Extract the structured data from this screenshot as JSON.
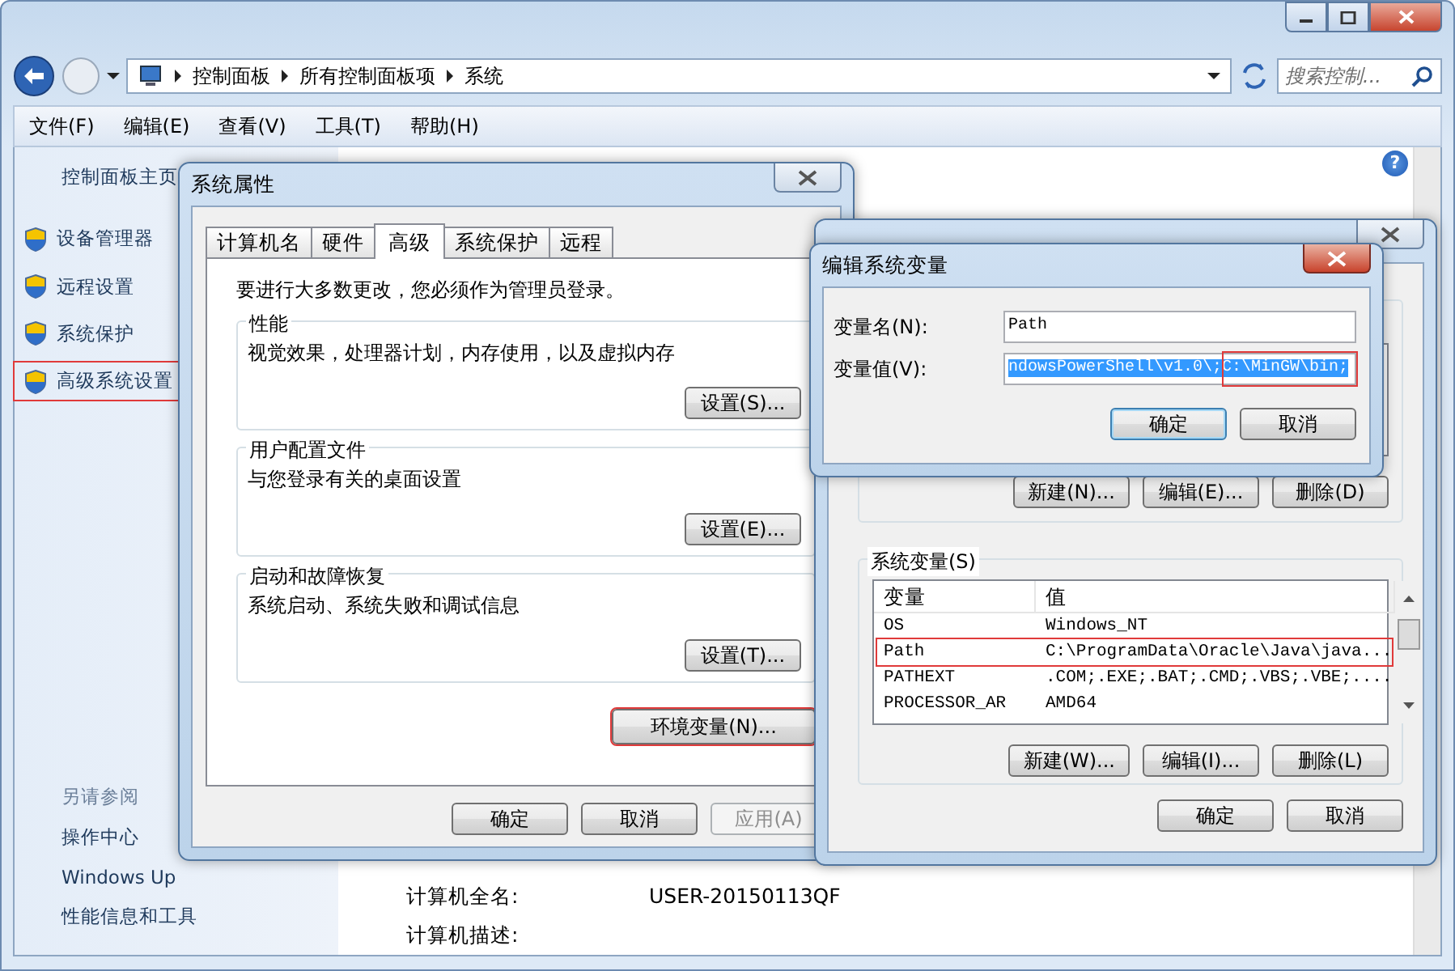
{
  "explorer": {
    "address": {
      "crumbs": [
        "控制面板",
        "所有控制面板项",
        "系统"
      ]
    },
    "search": {
      "placeholder": "搜索控制..."
    },
    "menu": [
      "文件(F)",
      "编辑(E)",
      "查看(V)",
      "工具(T)",
      "帮助(H)"
    ],
    "help": "?",
    "sidebar": {
      "home": "控制面板主页",
      "tasks": [
        {
          "label": "设备管理器",
          "highlighted": false
        },
        {
          "label": "远程设置",
          "highlighted": false
        },
        {
          "label": "系统保护",
          "highlighted": false
        },
        {
          "label": "高级系统设置",
          "highlighted": true
        }
      ],
      "see_also": "另请参阅",
      "links": [
        "操作中心",
        "Windows Up",
        "性能信息和工具"
      ]
    },
    "details": [
      {
        "label": "计算机全名:",
        "value": "USER-20150113QF"
      },
      {
        "label": "计算机描述:"
      }
    ]
  },
  "system_properties": {
    "title": "系统属性",
    "tabs": [
      {
        "label": "计算机名",
        "selected": false
      },
      {
        "label": "硬件",
        "selected": false
      },
      {
        "label": "高级",
        "selected": true
      },
      {
        "label": "系统保护",
        "selected": false
      },
      {
        "label": "远程",
        "selected": false
      }
    ],
    "note": "要进行大多数更改，您必须作为管理员登录。",
    "groups": [
      {
        "title": "性能",
        "description": "视觉效果，处理器计划，内存使用，以及虚拟内存",
        "button": "设置(S)..."
      },
      {
        "title": "用户配置文件",
        "description": "与您登录有关的桌面设置",
        "button": "设置(E)..."
      },
      {
        "title": "启动和故障恢复",
        "description": "系统启动、系统失败和调试信息",
        "button": "设置(T)..."
      }
    ],
    "env_button": {
      "label": "环境变量(N)...",
      "highlighted": true
    },
    "buttons": [
      {
        "label": "确定",
        "disabled": false
      },
      {
        "label": "取消",
        "disabled": false
      },
      {
        "label": "应用(A)",
        "disabled": true
      }
    ]
  },
  "environment_variables": {
    "user_buttons": [
      "新建(N)...",
      "编辑(E)...",
      "删除(D)"
    ],
    "system_group": "系统变量(S)",
    "columns": [
      "变量",
      "值"
    ],
    "rows": [
      {
        "name": "OS",
        "value": "Windows_NT",
        "highlighted": false
      },
      {
        "name": "Path",
        "value": "C:\\ProgramData\\Oracle\\Java\\java...",
        "highlighted": true
      },
      {
        "name": "PATHEXT",
        "value": ".COM;.EXE;.BAT;.CMD;.VBS;.VBE;....",
        "highlighted": false
      },
      {
        "name": "PROCESSOR_AR",
        "value": "AMD64",
        "highlighted": false
      }
    ],
    "system_buttons": [
      "新建(W)...",
      "编辑(I)...",
      "删除(L)"
    ],
    "buttons": [
      "确定",
      "取消"
    ]
  },
  "edit_dialog": {
    "title": "编辑系统变量",
    "fields": [
      {
        "label": "变量名(N):",
        "value": "Path",
        "selected": false,
        "annotated": false
      },
      {
        "label": "变量值(V):",
        "value": "ndowsPowerShell\\v1.0\\;C:\\MinGW\\bin;",
        "selected": true,
        "annotated": true
      }
    ],
    "buttons": [
      {
        "label": "确定",
        "default": true
      },
      {
        "label": "取消",
        "default": false
      }
    ]
  }
}
